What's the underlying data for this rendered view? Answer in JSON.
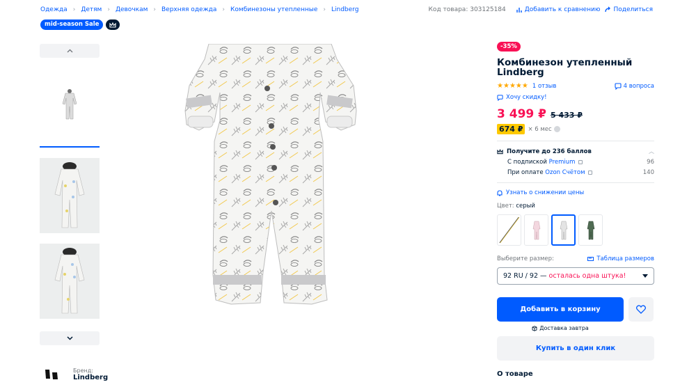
{
  "breadcrumbs": [
    "Одежда",
    "Детям",
    "Девочкам",
    "Верхняя одежда",
    "Комбинезоны утепленные",
    "Lindberg"
  ],
  "header": {
    "product_code": "Код товара: 303125184",
    "compare": "Добавить к сравнению",
    "share": "Поделиться"
  },
  "badges": {
    "sale": "mid-season Sale"
  },
  "brand": {
    "label": "Бренд:",
    "name": "Lindberg"
  },
  "product": {
    "discount": "-35%",
    "title": "Комбинезон утепленный Lindberg",
    "rating_value": 5,
    "reviews": "1 отзыв",
    "questions": "4 вопроса",
    "want_discount": "Хочу скидку!",
    "price": "3 499 ₽",
    "old_price": "5 433 ₽",
    "installment_price": "674 ₽",
    "installment_term": "× 6 мес"
  },
  "points": {
    "heading": "Получите до 236 баллов",
    "premium_prefix": "С подпиской",
    "premium_link": "Premium",
    "premium_value": "96",
    "account_prefix": "При оплате",
    "account_link": "Ozon Счётом",
    "account_value": "140"
  },
  "notify": "Узнать о снижении цены",
  "color": {
    "label": "Цвет:",
    "value": "серый"
  },
  "size": {
    "label": "Выберите размер:",
    "table_link": "Таблица размеров",
    "selected": "92 RU / 92 —",
    "warning": "осталась одна штука!"
  },
  "actions": {
    "add_to_cart": "Добавить в корзину",
    "delivery": "Доставка завтра",
    "buy_one_click": "Купить в один клик"
  },
  "about": "О товаре",
  "colors": {
    "accent": "#005bff",
    "sale": "#f91155",
    "installment": "#fec900",
    "star": "#ffa800"
  }
}
